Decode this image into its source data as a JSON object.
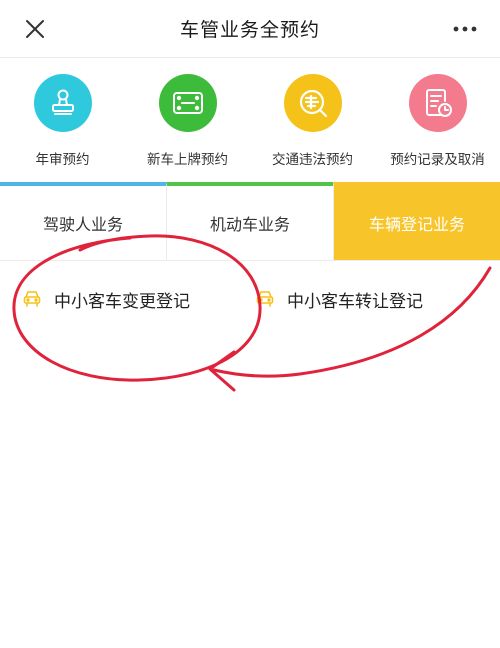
{
  "header": {
    "title": "车管业务全预约",
    "close_icon": "close-icon",
    "more_icon": "more-icon"
  },
  "services": [
    {
      "label": "年审预约",
      "icon": "stamp-icon",
      "color": "#2fc9de"
    },
    {
      "label": "新车上牌预约",
      "icon": "license-plate-icon",
      "color": "#3dbb3a"
    },
    {
      "label": "交通违法预约",
      "icon": "violation-search-icon",
      "color": "#f5c21a"
    },
    {
      "label": "预约记录及取消",
      "icon": "record-clock-icon",
      "color": "#f47b8e"
    }
  ],
  "tabs": [
    {
      "label": "驾驶人业务",
      "accent": "#4fb4e8"
    },
    {
      "label": "机动车业务",
      "accent": "#52c24a"
    },
    {
      "label": "车辆登记业务",
      "accent": "#f7c52a",
      "active": true
    }
  ],
  "items": [
    {
      "label": "中小客车变更登记",
      "icon": "car-icon"
    },
    {
      "label": "中小客车转让登记",
      "icon": "car-icon"
    }
  ],
  "annotation_color": "#e0223a"
}
